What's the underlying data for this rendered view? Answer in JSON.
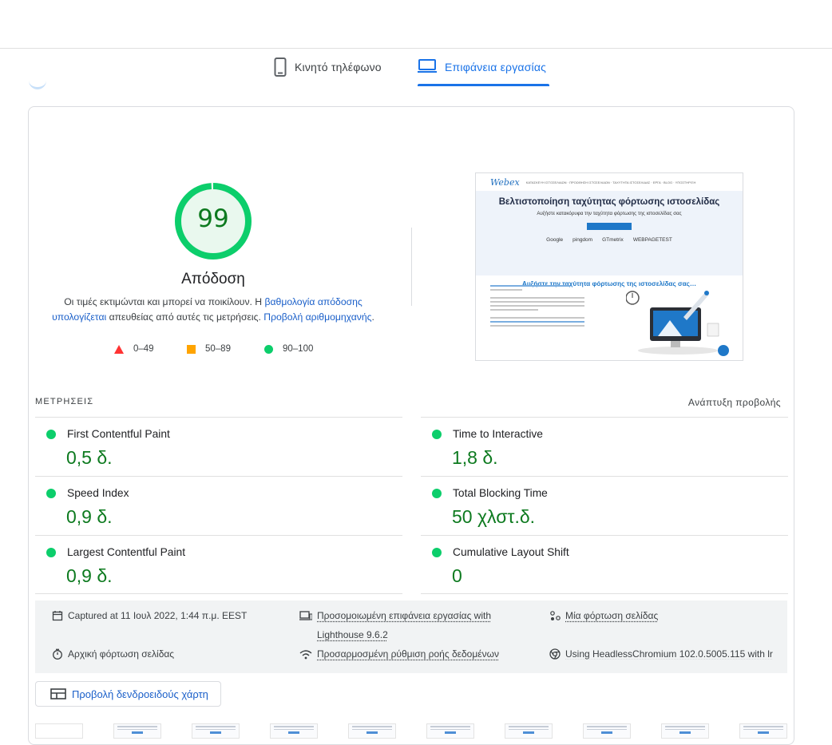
{
  "tabs": {
    "mobile_label": "Κινητό τηλέφωνο",
    "desktop_label": "Επιφάνεια εργασίας",
    "active": "desktop"
  },
  "score": {
    "value": "99",
    "title": "Απόδοση",
    "desc_1": "Οι τιμές εκτιμώνται και μπορεί να ποικίλουν. Η ",
    "desc_link_1": "βαθμολογία απόδοσης υπολογίζεται",
    "desc_2": " απευθείας από αυτές τις μετρήσεις. ",
    "desc_link_2": "Προβολή αριθμομηχανής",
    "desc_3": ".",
    "score_fraction": 0.99,
    "color": "#0cce6b"
  },
  "legend": {
    "fail": "0–49",
    "average": "50–89",
    "pass": "90–100"
  },
  "screenshot": {
    "logo": "Webex",
    "nav": "ΚΑΤΑΣΚΕΥΗ ΙΣΤΟΣΕΛΙΔΩΝ · ΠΡΟΩΘΗΣΗ ΙΣΤΟΣΕΛΙΔΩΝ · ΤΑΧΥΤΗΤΑ ΙΣΤΟΣΕΛΙΔΑΣ · ΕΡΓΑ · BLOG · ΥΠΟΣΤΗΡΙΞΗ",
    "headline": "Βελτιστοποίηση ταχύτητας φόρτωσης ιστοσελίδας",
    "subline": "Αυξήστε κατακόρυφα την ταχύτητα φόρτωσης της ιστοσελίδας σας",
    "tools": [
      "Google",
      "pingdom",
      "GTmetrix",
      "WEBPAGETEST"
    ],
    "section_heading": "Αυξήστε την ταχύτητα φόρτωσης της ιστοσελίδας σας…"
  },
  "metrics": {
    "title": "ΜΕΤΡΗΣΕΙΣ",
    "expand": "Ανάπτυξη προβολής",
    "items": [
      {
        "name": "First Contentful Paint",
        "value": "0,5 δ."
      },
      {
        "name": "Time to Interactive",
        "value": "1,8 δ."
      },
      {
        "name": "Speed Index",
        "value": "0,9 δ."
      },
      {
        "name": "Total Blocking Time",
        "value": "50 χλστ.δ."
      },
      {
        "name": "Largest Contentful Paint",
        "value": "0,9 δ."
      },
      {
        "name": "Cumulative Layout Shift",
        "value": "0"
      }
    ]
  },
  "runtime": {
    "captured": "Captured at 11 Ιουλ 2022, 1:44 π.μ. EEST",
    "emulation_1": "Προσομοιωμένη επιφάνεια εργασίας with",
    "emulation_2": "Lighthouse 9.6.2",
    "single_load": "Μία φόρτωση σελίδας",
    "initial_load": "Αρχική φόρτωση σελίδας",
    "throttling": "Προσαρμοσμένη ρύθμιση ροής δεδομένων",
    "browser": "Using HeadlessChromium 102.0.5005.115 with lr"
  },
  "treemap": {
    "label": "Προβολή δενδροειδούς χάρτη"
  }
}
